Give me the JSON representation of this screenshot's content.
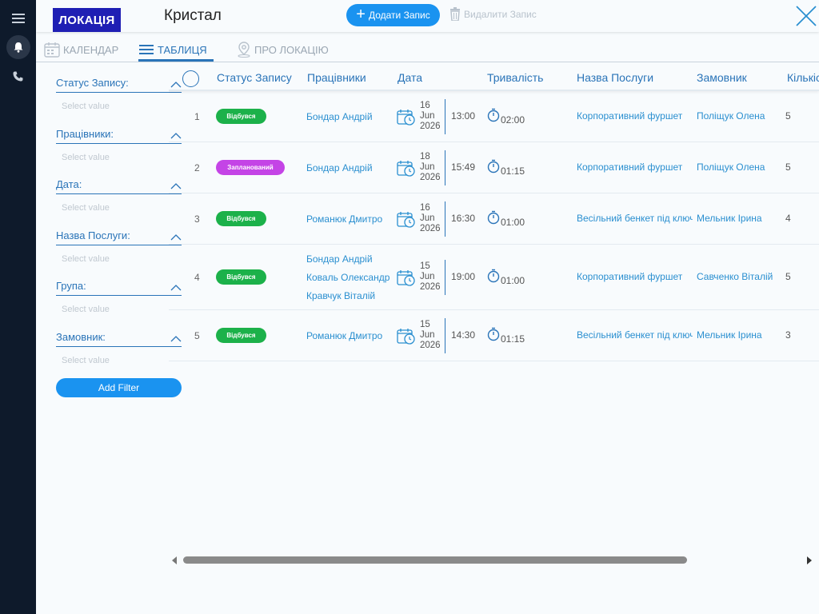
{
  "header": {
    "location_badge": "ЛОКАЦІЯ",
    "location_name": "Кристал",
    "add_record": "Додати Запис",
    "delete_record": "Видалити Запис"
  },
  "tabs": [
    {
      "label": "КАЛЕНДАР",
      "icon": "calendar-icon",
      "active": false
    },
    {
      "label": "ТАБЛИЦЯ",
      "icon": "list-icon",
      "active": true
    },
    {
      "label": "ПРО ЛОКАЦІЮ",
      "icon": "location-pin-icon",
      "active": false
    }
  ],
  "filters": {
    "items": [
      {
        "label": "Статус Запису:",
        "placeholder": "Select value"
      },
      {
        "label": "Працівники:",
        "placeholder": "Select value"
      },
      {
        "label": "Дата:",
        "placeholder": "Select value"
      },
      {
        "label": "Назва Послуги:",
        "placeholder": "Select value"
      },
      {
        "label": "Група:",
        "placeholder": "Select value"
      },
      {
        "label": "Замовник:",
        "placeholder": "Select value"
      }
    ],
    "add_filter": "Add Filter"
  },
  "table": {
    "columns": [
      "Статус Запису",
      "Працівники",
      "Дата",
      "Тривалість",
      "Назва Послуги",
      "Замовник",
      "Кількість"
    ],
    "rows": [
      {
        "num": "1",
        "status": "Відбувся",
        "status_type": "done",
        "employees": [
          "Бондар Андрій"
        ],
        "day": "16",
        "month": "Jun",
        "year": "2026",
        "time": "13:00",
        "duration": "02:00",
        "service": "Корпоративний фуршет",
        "customer": "Поліщук Олена",
        "qty": "5"
      },
      {
        "num": "2",
        "status": "Запланований",
        "status_type": "plan",
        "employees": [
          "Бондар Андрій"
        ],
        "day": "18",
        "month": "Jun",
        "year": "2026",
        "time": "15:49",
        "duration": "01:15",
        "service": "Корпоративний фуршет",
        "customer": "Поліщук Олена",
        "qty": "5"
      },
      {
        "num": "3",
        "status": "Відбувся",
        "status_type": "done",
        "employees": [
          "Романюк Дмитро"
        ],
        "day": "16",
        "month": "Jun",
        "year": "2026",
        "time": "16:30",
        "duration": "01:00",
        "service": "Весільний бенкет під ключ",
        "customer": "Мельник Ірина",
        "qty": "4"
      },
      {
        "num": "4",
        "status": "Відбувся",
        "status_type": "done",
        "employees": [
          "Бондар Андрій",
          "Коваль Олександр",
          "Кравчук Віталій"
        ],
        "day": "15",
        "month": "Jun",
        "year": "2026",
        "time": "19:00",
        "duration": "01:00",
        "service": "Корпоративний фуршет",
        "customer": "Савченко Віталій",
        "qty": "5"
      },
      {
        "num": "5",
        "status": "Відбувся",
        "status_type": "done",
        "employees": [
          "Романюк Дмитро"
        ],
        "day": "15",
        "month": "Jun",
        "year": "2026",
        "time": "14:30",
        "duration": "01:15",
        "service": "Весільний бенкет під ключ",
        "customer": "Мельник Ірина",
        "qty": "3"
      }
    ]
  },
  "colors": {
    "accent": "#1a93f0",
    "link": "#2a74b8",
    "status_done": "#1cb14a",
    "status_plan": "#c444e6",
    "rail": "#0e1a2b",
    "badge": "#1f1fb4"
  }
}
